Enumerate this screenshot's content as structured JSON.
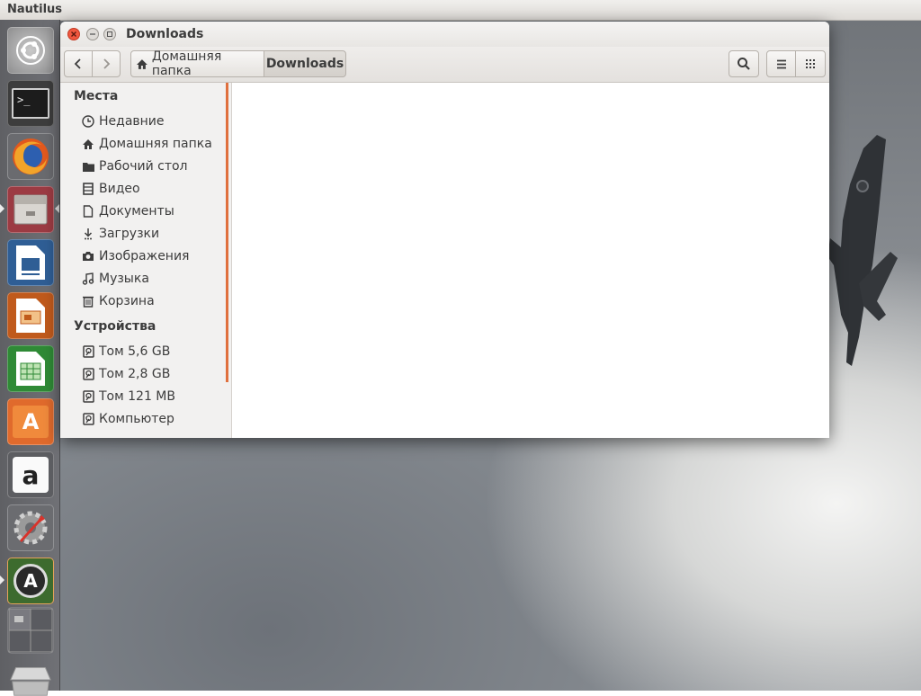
{
  "top_panel": {
    "app_name": "Nautilus"
  },
  "launcher": {
    "items": [
      {
        "name": "Ubuntu Dash",
        "icon": "ubuntu-logo-icon"
      },
      {
        "name": "Terminal",
        "icon": "terminal-icon",
        "glyph": ">_"
      },
      {
        "name": "Firefox",
        "icon": "firefox-icon"
      },
      {
        "name": "Files",
        "icon": "file-cabinet-icon",
        "active": true
      },
      {
        "name": "LibreOffice Writer",
        "icon": "writer-icon"
      },
      {
        "name": "LibreOffice Impress",
        "icon": "impress-icon"
      },
      {
        "name": "LibreOffice Calc",
        "icon": "calc-icon"
      },
      {
        "name": "Ubuntu Software Center",
        "icon": "software-center-icon",
        "glyph": "A"
      },
      {
        "name": "Amazon",
        "icon": "amazon-icon",
        "glyph": "a"
      },
      {
        "name": "System Settings",
        "icon": "settings-icon"
      },
      {
        "name": "Software Updater",
        "icon": "software-updater-icon",
        "glyph": "A"
      },
      {
        "name": "Workspace Switcher",
        "icon": "workspace-switcher-icon"
      },
      {
        "name": "Trash",
        "icon": "trash-icon"
      }
    ]
  },
  "window": {
    "title": "Downloads",
    "toolbar": {
      "back": "back-icon",
      "forward": "forward-icon",
      "breadcrumb": [
        "Домашняя папка",
        "Downloads"
      ],
      "search": "search-icon",
      "list_view": "list-view-icon",
      "grid_view": "grid-view-icon"
    },
    "sidebar": {
      "places_heading": "Места",
      "places": [
        {
          "label": "Недавние",
          "icon": "clock-icon"
        },
        {
          "label": "Домашняя папка",
          "icon": "home-icon"
        },
        {
          "label": "Рабочий стол",
          "icon": "folder-icon"
        },
        {
          "label": "Видео",
          "icon": "film-icon"
        },
        {
          "label": "Документы",
          "icon": "document-icon"
        },
        {
          "label": "Загрузки",
          "icon": "download-icon"
        },
        {
          "label": "Изображения",
          "icon": "camera-icon"
        },
        {
          "label": "Музыка",
          "icon": "music-icon"
        },
        {
          "label": "Корзина",
          "icon": "trash-icon"
        }
      ],
      "devices_heading": "Устройства",
      "devices": [
        {
          "label": "Том 5,6 GB",
          "icon": "drive-icon"
        },
        {
          "label": "Том 2,8 GB",
          "icon": "drive-icon"
        },
        {
          "label": "Том 121 MB",
          "icon": "drive-icon"
        },
        {
          "label": "Компьютер",
          "icon": "drive-icon"
        }
      ]
    }
  },
  "colors": {
    "accent": "#e0703e",
    "close_button": "#f0573f",
    "launcher_bg": "#66676b"
  }
}
